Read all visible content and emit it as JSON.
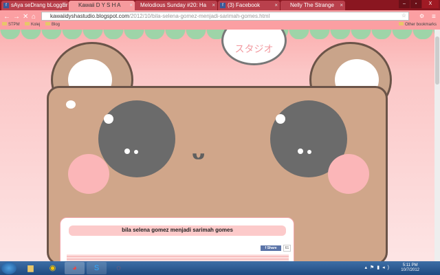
{
  "browser": {
    "tabs": [
      {
        "label": "sAya seDrang bLoggEr",
        "icon": "facebook-icon"
      },
      {
        "label": "Kawaii D Y S H A",
        "icon": "site-icon",
        "active": true
      },
      {
        "label": "Melodious Sunday #20: Ha",
        "icon": "page-icon"
      },
      {
        "label": "(3) Facebook",
        "icon": "facebook-icon"
      },
      {
        "label": "Nelly The Strange",
        "icon": "page-icon"
      }
    ],
    "url_host": "kawaiidyshastudio.blogspot.com",
    "url_path": "/2012/10/bila-selena-gomez-menjadi-sarimah-gomes.html",
    "bookmarks": [
      "STPM",
      "Kolej",
      "Blog"
    ],
    "other_bookmarks": "Other bookmarks"
  },
  "header": {
    "logo_text": "スタジオ"
  },
  "post": {
    "title": "bila selena gomez menjadi sarimah gomes",
    "share_label": "Share",
    "share_count": "61"
  },
  "taskbar": {
    "time": "5:11 PM",
    "date": "10/7/2012"
  },
  "colors": {
    "toolbar": "#fb9fa2",
    "bear": "#d0a68a",
    "eye": "#6b6b6b",
    "blush": "#fbb6b8"
  }
}
